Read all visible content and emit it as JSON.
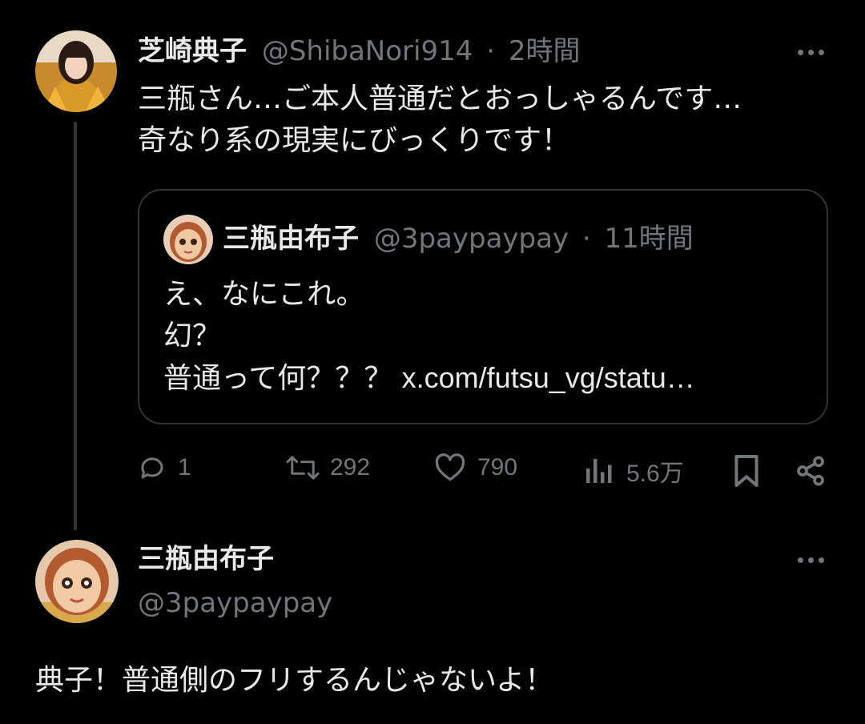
{
  "tweet": {
    "author_name": "芝崎典子",
    "author_handle": "@ShibaNori914",
    "separator": "·",
    "time": "2時間",
    "text_line1": "三瓶さん…ご本人普通だとおっしゃるんです…",
    "text_line2": "奇なり系の現実にびっくりです！",
    "quote": {
      "author_name": "三瓶由布子",
      "author_handle": "@3paypaypay",
      "separator": "·",
      "time": "11時間",
      "line1": "え、なにこれ。",
      "line2": "幻？",
      "line3_text": "普通って何？？？ ",
      "line3_link": "x.com/futsu_vg/statu…"
    },
    "stats": {
      "replies": "1",
      "retweets": "292",
      "likes": "790",
      "views": "5.6万"
    }
  },
  "reply": {
    "author_name": "三瓶由布子",
    "author_handle": "@3paypaypay",
    "text": "典子！普通側のフリするんじゃないよ！"
  },
  "colors": {
    "background": "#000000",
    "text": "#e7e9ea",
    "muted": "#71767b",
    "border": "#2f3336"
  },
  "icons": [
    "more-icon",
    "reply-icon",
    "retweet-icon",
    "like-icon",
    "views-icon",
    "bookmark-icon",
    "share-icon"
  ]
}
